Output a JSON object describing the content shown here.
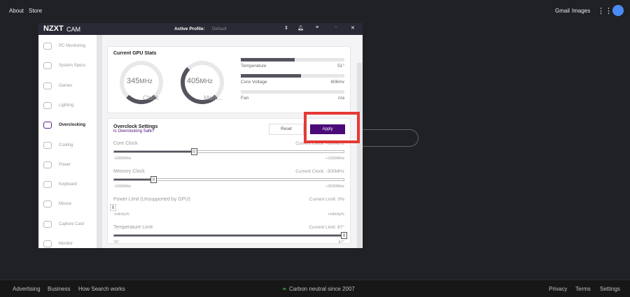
{
  "google": {
    "top_left": [
      "About",
      "Store"
    ],
    "top_right": [
      "Gmail",
      "Images"
    ],
    "footer_left": [
      "Advertising",
      "Business",
      "How Search works"
    ],
    "footer_center": "Carbon neutral since 2007",
    "footer_right": [
      "Privacy",
      "Terms",
      "Settings"
    ]
  },
  "cam": {
    "logo": "NZXT",
    "logo_sub": "CAM",
    "active_profile_label": "Active Profile:",
    "active_profile_value": "Default",
    "sidebar": [
      "PC Monitoring",
      "System Specs",
      "Games",
      "Lighting",
      "Overclocking",
      "Cooling",
      "Power",
      "Keyboard",
      "Mouse",
      "Capture Card",
      "Monitor"
    ],
    "active_item": "Overclocking",
    "gpu": {
      "title": "Current GPU Stats",
      "clock_value": "345",
      "clock_unit": "MHz",
      "clock_label": "Clock",
      "mem_value": "405",
      "mem_unit": "MHz",
      "mem_label": "Mem...",
      "stats": [
        {
          "label": "Temperature",
          "value": "51°",
          "fill": 0.52
        },
        {
          "label": "Core Voltage",
          "value": "606mv",
          "fill": 0.58
        },
        {
          "label": "Fan",
          "value": "n/a",
          "fill": 0
        }
      ]
    },
    "oc": {
      "title": "Overclock Settings",
      "link": "Is Overclocking Safe?",
      "reset": "Reset",
      "apply": "Apply",
      "sliders": [
        {
          "label": "Core Clock",
          "current": "Current Clock: -300MHz",
          "min": "-1000MHz",
          "max": "+1000MHz",
          "pos": 0.35
        },
        {
          "label": "Memory Clock",
          "current": "Current Clock: -300MHz",
          "min": "-1000MHz",
          "max": "+3000MHz",
          "pos": 0.175
        },
        {
          "label": "Power Limit (Unsupported by GPU)",
          "current": "Current Limit: 0%",
          "min": "-Infinity%",
          "max": "+Infinity%",
          "pos": 0
        },
        {
          "label": "Temperature Limit",
          "current": "Current Limit: 87°",
          "min": "75°",
          "max": "87°",
          "pos": 1
        }
      ]
    }
  },
  "colors": {
    "accent": "#4a0a78",
    "highlight": "#e53935"
  }
}
